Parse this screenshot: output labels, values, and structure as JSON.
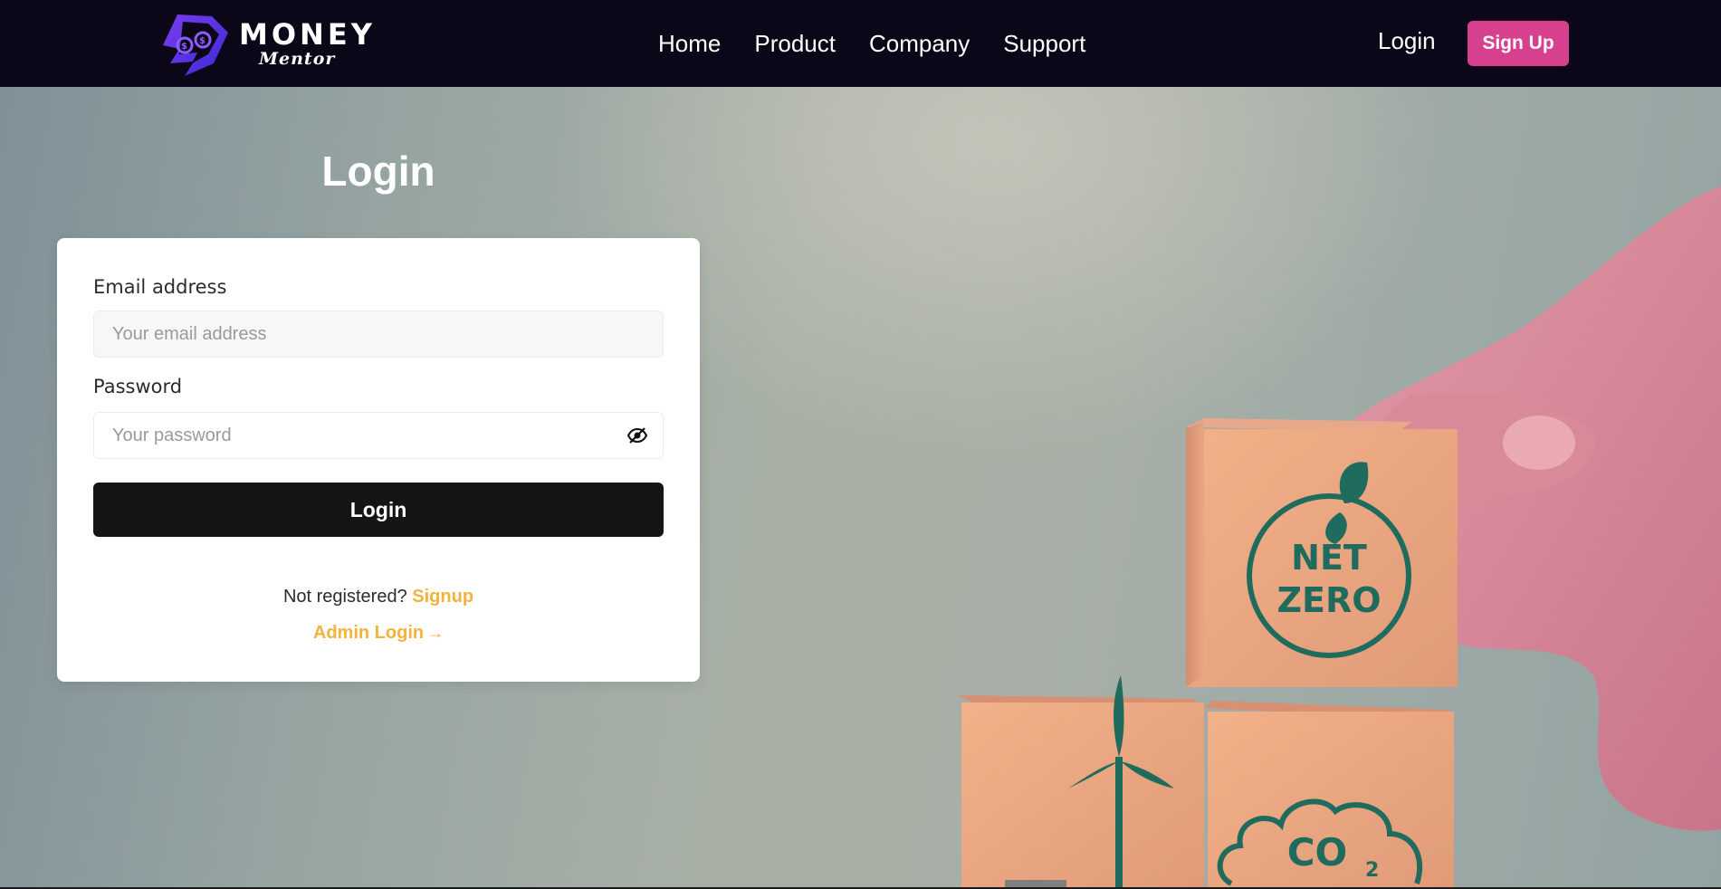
{
  "brand": {
    "name": "MONEY",
    "tagline": "Mentor"
  },
  "nav": {
    "links": [
      "Home",
      "Product",
      "Company",
      "Support"
    ],
    "login_label": "Login",
    "signup_label": "Sign Up"
  },
  "login_form": {
    "title": "Login",
    "email_label": "Email address",
    "email_placeholder": "Your email address",
    "password_label": "Password",
    "password_placeholder": "Your password",
    "password_toggle_icon": "eye-slash-icon",
    "submit_label": "Login",
    "register_prompt": "Not registered?",
    "register_link": "Signup",
    "admin_link": "Admin Login",
    "admin_arrow": "→"
  },
  "hero_image": {
    "blocks": {
      "top": [
        "NET",
        "ZERO"
      ],
      "co2": "CO",
      "co2_sub": "2"
    }
  },
  "colors": {
    "nav_bg": "#0b0718",
    "accent_pink": "#d6408e",
    "link_orange": "#f5b23c",
    "button_dark": "#151515",
    "icon_green": "#1f6b5d"
  }
}
